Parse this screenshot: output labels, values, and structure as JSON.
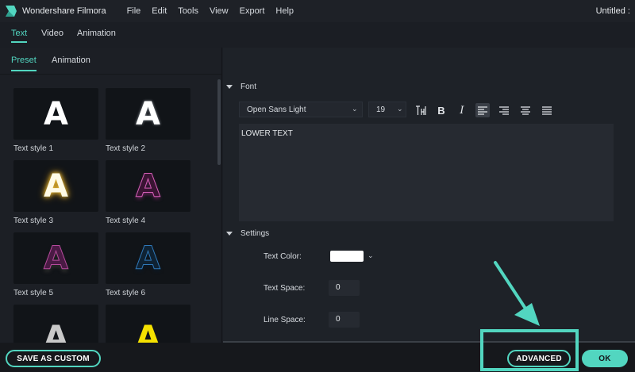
{
  "app": {
    "name": "Wondershare Filmora",
    "doc_title": "Untitled :"
  },
  "menu": [
    "File",
    "Edit",
    "Tools",
    "View",
    "Export",
    "Help"
  ],
  "top_tabs": [
    {
      "label": "Text",
      "active": true
    },
    {
      "label": "Video",
      "active": false
    },
    {
      "label": "Animation",
      "active": false
    }
  ],
  "sub_tabs": [
    {
      "label": "Preset",
      "active": true
    },
    {
      "label": "Animation",
      "active": false
    }
  ],
  "presets": [
    {
      "label": "Text style 1",
      "glyph": "A"
    },
    {
      "label": "Text style 2",
      "glyph": "A"
    },
    {
      "label": "Text style 3",
      "glyph": "A"
    },
    {
      "label": "Text style 4",
      "glyph": "A"
    },
    {
      "label": "Text style 5",
      "glyph": "A"
    },
    {
      "label": "Text style 6",
      "glyph": "A"
    },
    {
      "glyph": "A"
    },
    {
      "glyph": "A"
    }
  ],
  "font_section": {
    "header": "Font",
    "font_family": "Open Sans Light",
    "font_size": "19",
    "bold": "B",
    "italic": "I",
    "text_value": "LOWER TEXT"
  },
  "settings_section": {
    "header": "Settings",
    "text_color_label": "Text Color:",
    "text_color": "#ffffff",
    "text_space_label": "Text Space:",
    "text_space_value": "0",
    "line_space_label": "Line Space:",
    "line_space_value": "0"
  },
  "buttons": {
    "save_custom": "SAVE AS CUSTOM",
    "advanced": "ADVANCED",
    "ok": "OK"
  },
  "accent_color": "#52d6c0"
}
